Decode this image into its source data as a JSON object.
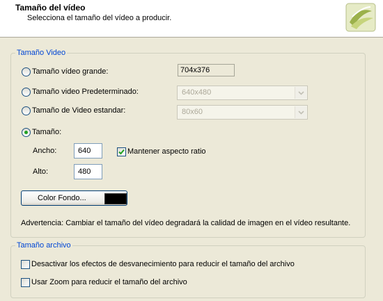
{
  "header": {
    "title": "Tamaño del vídeo",
    "subtitle": "Selecciona el tamaño del vídeo a producir."
  },
  "video_size_group": {
    "legend": "Tamaño Video",
    "options": [
      {
        "label": "Tamaño vídeo grande:",
        "value": "704x376",
        "selected": false
      },
      {
        "label": "Tamaño video Predeterminado:",
        "value": "640x480",
        "selected": false
      },
      {
        "label": "Tamaño de Video estandar:",
        "value": "80x60",
        "selected": false
      },
      {
        "label": "Tamaño:",
        "selected": true
      }
    ],
    "width_label": "Ancho:",
    "width_value": "640",
    "height_label": "Alto:",
    "height_value": "480",
    "keep_aspect_label": "Mantener aspecto ratio",
    "keep_aspect_checked": true,
    "bg_color_button": "Color Fondo...",
    "bg_color": "#000000",
    "warning": "Advertencia: Cambiar el tamaño del vídeo degradará la calidad de imagen en el vídeo resultante."
  },
  "file_size_group": {
    "legend": "Tamaño archivo",
    "options": [
      {
        "label": "Desactivar los efectos de desvanecimiento para reducir el tamaño del archivo",
        "checked": false
      },
      {
        "label": "Usar Zoom para reducir el tamaño del archivo",
        "checked": false
      }
    ]
  },
  "colors": {
    "accent": "#0046d5",
    "radio_selected": "#21a121",
    "background": "#ece9d8"
  }
}
